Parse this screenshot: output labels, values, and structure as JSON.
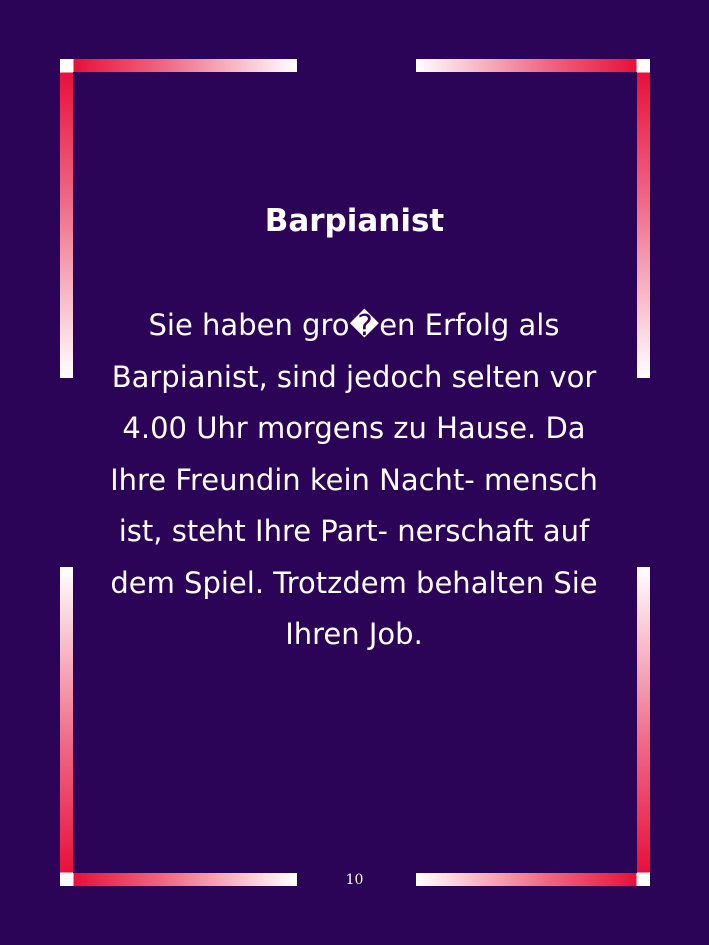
{
  "card": {
    "title": "Barpianist",
    "text": "Sie haben gro�en Erfolg als Barpianist, sind jedoch selten vor 4.00 Uhr morgens zu Hause. Da Ihre Freundin kein Nacht- mensch ist, steht Ihre Part- nerschaft auf dem Spiel. Trotzdem behalten Sie Ihren Job.",
    "page_number": "10"
  },
  "colors": {
    "background": "#2c0457",
    "frame_red": "#e8103a",
    "frame_white": "#ffffff",
    "text": "#ffffff"
  }
}
